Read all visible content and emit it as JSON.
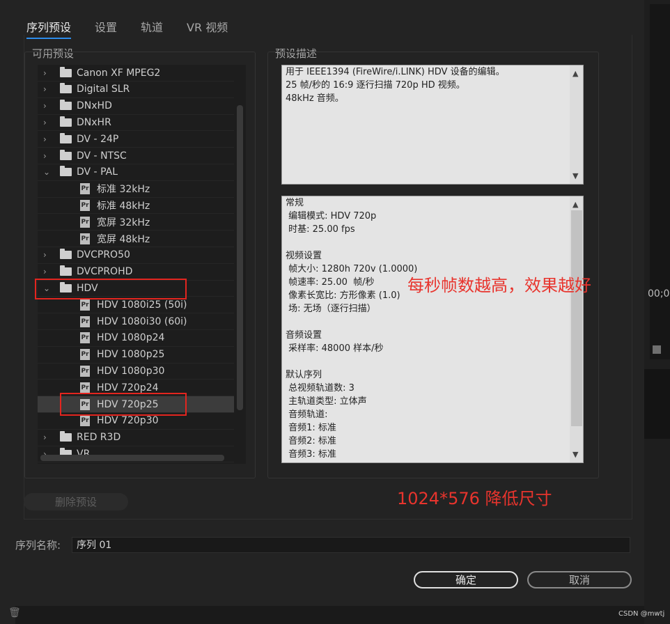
{
  "tabs": [
    "序列预设",
    "设置",
    "轨道",
    "VR 视频"
  ],
  "available_presets_label": "可用预设",
  "preset_description_label": "预设描述",
  "tree": [
    {
      "label": "Canon XF MPEG2",
      "kind": "folder",
      "expanded": false
    },
    {
      "label": "Digital SLR",
      "kind": "folder",
      "expanded": false
    },
    {
      "label": "DNxHD",
      "kind": "folder",
      "expanded": false
    },
    {
      "label": "DNxHR",
      "kind": "folder",
      "expanded": false
    },
    {
      "label": "DV - 24P",
      "kind": "folder",
      "expanded": false
    },
    {
      "label": "DV - NTSC",
      "kind": "folder",
      "expanded": false
    },
    {
      "label": "DV - PAL",
      "kind": "folder",
      "expanded": true
    },
    {
      "label": "标准 32kHz",
      "kind": "preset"
    },
    {
      "label": "标准 48kHz",
      "kind": "preset"
    },
    {
      "label": "宽屏 32kHz",
      "kind": "preset"
    },
    {
      "label": "宽屏 48kHz",
      "kind": "preset"
    },
    {
      "label": "DVCPRO50",
      "kind": "folder",
      "expanded": false
    },
    {
      "label": "DVCPROHD",
      "kind": "folder",
      "expanded": false
    },
    {
      "label": "HDV",
      "kind": "folder",
      "expanded": true
    },
    {
      "label": "HDV 1080i25 (50i)",
      "kind": "preset"
    },
    {
      "label": "HDV 1080i30 (60i)",
      "kind": "preset"
    },
    {
      "label": "HDV 1080p24",
      "kind": "preset"
    },
    {
      "label": "HDV 1080p25",
      "kind": "preset"
    },
    {
      "label": "HDV 1080p30",
      "kind": "preset"
    },
    {
      "label": "HDV 720p24",
      "kind": "preset"
    },
    {
      "label": "HDV 720p25",
      "kind": "preset",
      "selected": true
    },
    {
      "label": "HDV 720p30",
      "kind": "preset"
    },
    {
      "label": "RED R3D",
      "kind": "folder",
      "expanded": false
    },
    {
      "label": "VR",
      "kind": "folder",
      "expanded": false
    }
  ],
  "preset_icon_text": "Pr",
  "description_lines": [
    "用于 IEEE1394 (FireWire/i.LINK) HDV 设备的编辑。",
    "25 帧/秒的 16:9 逐行扫描 720p HD 视频。",
    "48kHz 音频。"
  ],
  "details_lines": [
    "常规",
    " 编辑模式: HDV 720p",
    " 时基: 25.00 fps",
    "",
    "视频设置",
    " 帧大小: 1280h 720v (1.0000)",
    " 帧速率: 25.00  帧/秒",
    " 像素长宽比: 方形像素 (1.0)",
    " 场: 无场（逐行扫描）",
    "",
    "音频设置",
    " 采样率: 48000 样本/秒",
    "",
    "默认序列",
    " 总视频轨道数: 3",
    " 主轨道类型: 立体声",
    " 音频轨道:",
    " 音频1: 标准",
    " 音频2: 标准",
    " 音频3: 标准"
  ],
  "annotations": {
    "framerate_note": "每秒帧数越高，效果越好",
    "size_note": "1024*576 降低尺寸"
  },
  "delete_preset_label": "删除预设",
  "sequence_name_label": "序列名称:",
  "sequence_name_value": "序列 01",
  "ok_label": "确定",
  "cancel_label": "取消",
  "bg_timecode": "00;0",
  "watermark": "CSDN @mwtj",
  "colors": {
    "accent": "#2d8ceb",
    "annotation": "#e8342d"
  }
}
